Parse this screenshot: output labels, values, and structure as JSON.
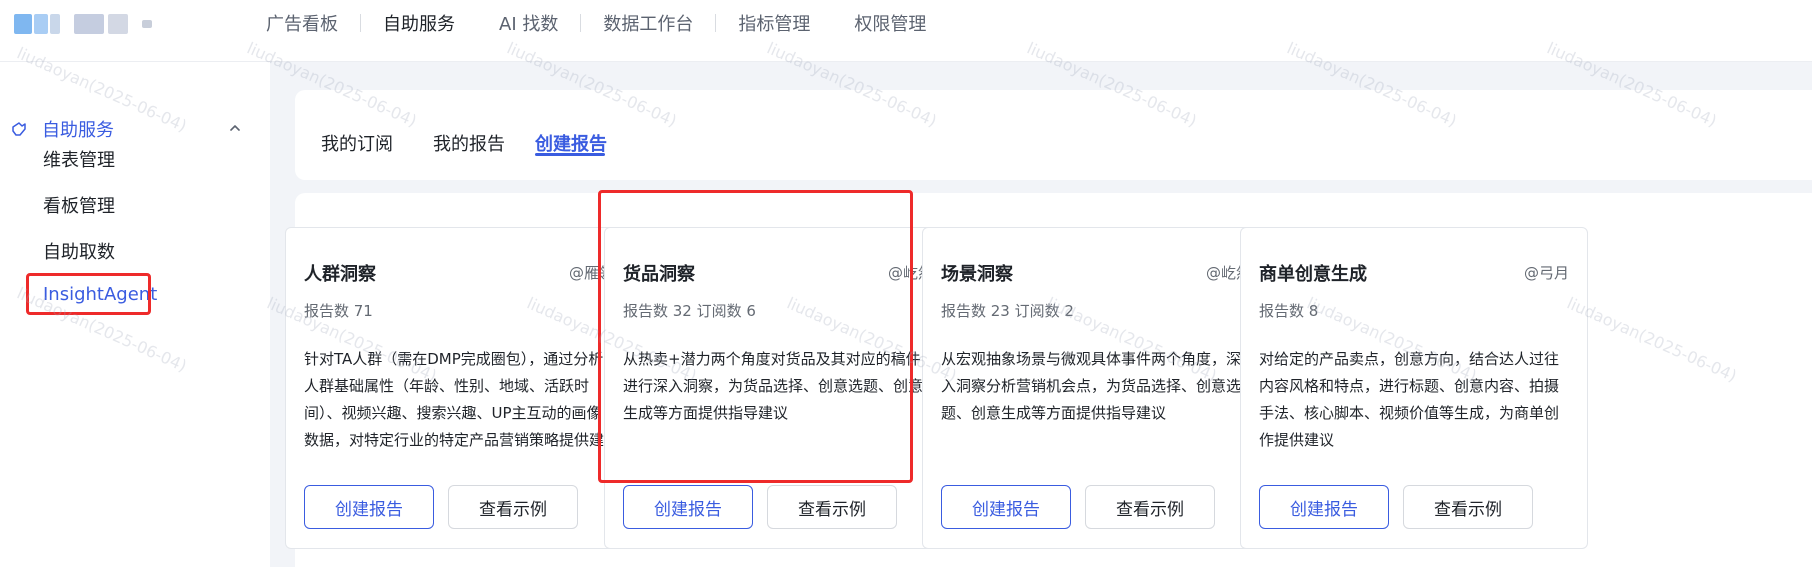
{
  "topnav": {
    "items": [
      "广告看板",
      "自助服务",
      "AI 找数",
      "数据工作台",
      "指标管理",
      "权限管理"
    ],
    "active_index": 1
  },
  "sidebar": {
    "group_label": "自助服务",
    "items": [
      "维表管理",
      "看板管理",
      "自助取数",
      "InsightAgent"
    ]
  },
  "tabs": [
    "我的订阅",
    "我的报告",
    "创建报告"
  ],
  "active_tab": "创建报告",
  "cards": [
    {
      "title": "人群洞察",
      "author": "@雁翎",
      "stats": "报告数 71",
      "description": "针对TA人群（需在DMP完成圈包），通过分析人群基础属性（年龄、性别、地域、活跃时间）、视频兴趣、搜索兴趣、UP主互动的画像数据，对特定行业的特定产品营销策略提供建议",
      "primary_button": "创建报告",
      "secondary_button": "查看示例"
    },
    {
      "title": "货品洞察",
      "author": "@屹然",
      "stats": "报告数 32 订阅数 6",
      "description": "从热卖+潜力两个角度对货品及其对应的稿件进行深入洞察，为货品选择、创意选题、创意生成等方面提供指导建议",
      "primary_button": "创建报告",
      "secondary_button": "查看示例"
    },
    {
      "title": "场景洞察",
      "author": "@屹然",
      "stats": "报告数 23 订阅数 2",
      "description": "从宏观抽象场景与微观具体事件两个角度，深入洞察分析营销机会点，为货品选择、创意选题、创意生成等方面提供指导建议",
      "primary_button": "创建报告",
      "secondary_button": "查看示例"
    },
    {
      "title": "商单创意生成",
      "author": "@弓月",
      "stats": "报告数 8",
      "description": "对给定的产品卖点，创意方向，结合达人过往内容风格和特点，进行标题、创意内容、拍摄手法、核心脚本、视频价值等生成，为商单创作提供建议",
      "primary_button": "创建报告",
      "secondary_button": "查看示例"
    }
  ],
  "watermark_text": "liudaoyan(2025-06-04)",
  "colors": {
    "accent": "#3a5ce0",
    "highlight": "#ee2a2a",
    "background": "#f2f4f8"
  },
  "icons": {
    "sidebar_group": "service-icon",
    "sidebar_toggle": "chevron-up-icon"
  }
}
